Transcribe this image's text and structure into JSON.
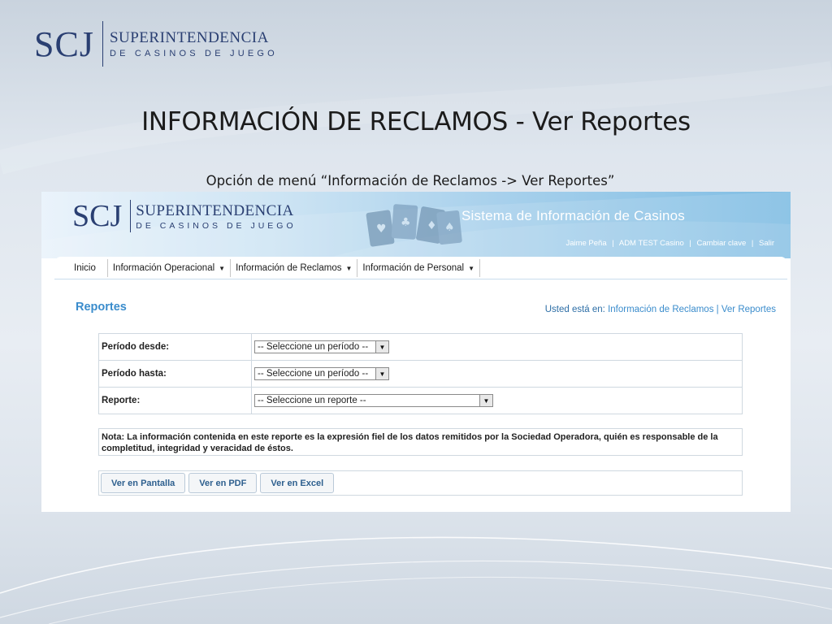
{
  "slide": {
    "logo": {
      "mark": "SCJ",
      "line1": "SUPERINTENDENCIA",
      "line2": "DE CASINOS DE JUEGO"
    },
    "title": "INFORMACIÓN DE RECLAMOS - Ver Reportes",
    "subtitle": "Opción de menú “Información de Reclamos -> Ver Reportes”"
  },
  "app": {
    "logo": {
      "mark": "SCJ",
      "line1": "SUPERINTENDENCIA",
      "line2": "DE CASINOS DE JUEGO"
    },
    "system_title": "Sistema de Información de Casinos",
    "user_links": {
      "user": "Jaime Peña",
      "casino": "ADM TEST Casino",
      "change_password": "Cambiar clave",
      "logout": "Salir",
      "separator": "|"
    },
    "menu": [
      {
        "label": "Inicio",
        "has_dropdown": false
      },
      {
        "label": "Información Operacional",
        "has_dropdown": true
      },
      {
        "label": "Información de Reclamos",
        "has_dropdown": true
      },
      {
        "label": "Información de Personal",
        "has_dropdown": true
      }
    ],
    "page_heading": "Reportes",
    "breadcrumb": {
      "label": "Usted está en:",
      "section": "Información de Reclamos",
      "separator": "|",
      "page": "Ver Reportes"
    },
    "form": {
      "period_from": {
        "label": "Período desde:",
        "value": "-- Seleccione un período --"
      },
      "period_to": {
        "label": "Período hasta:",
        "value": "-- Seleccione un período --"
      },
      "report": {
        "label": "Reporte:",
        "value": "-- Seleccione un reporte --"
      }
    },
    "note": "Nota: La información contenida en este reporte es la expresión fiel de los datos remitidos por la Sociedad Operadora, quién es responsable de la completitud, integridad y veracidad de éstos.",
    "buttons": {
      "screen": "Ver en Pantalla",
      "pdf": "Ver en PDF",
      "excel": "Ver en Excel"
    },
    "icons": {
      "dropdown_caret": "▼"
    }
  }
}
